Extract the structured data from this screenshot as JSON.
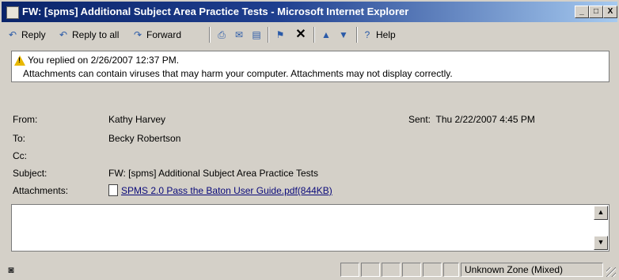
{
  "window": {
    "title": "FW: [spms] Additional Subject Area Practice Tests - Microsoft Internet Explorer",
    "controls": {
      "minimize": "_",
      "maximize": "□",
      "close": "X"
    }
  },
  "toolbar": {
    "reply": "Reply",
    "reply_all": "Reply to all",
    "forward": "Forward",
    "help": "Help"
  },
  "infobar": {
    "replied": "You replied on 2/26/2007 12:37 PM.",
    "attachment_warning": "Attachments can contain viruses that may harm your computer. Attachments may not display correctly."
  },
  "header": {
    "from_label": "From:",
    "from_value": "Kathy Harvey",
    "sent_label": "Sent:",
    "sent_value": "Thu 2/22/2007 4:45 PM",
    "to_label": "To:",
    "to_value": "Becky Robertson",
    "cc_label": "Cc:",
    "cc_value": "",
    "subject_label": "Subject:",
    "subject_value": "FW: [spms] Additional Subject Area Practice Tests",
    "attachments_label": "Attachments:",
    "attachment_name": "SPMS 2.0  Pass the Baton User Guide.pdf(844KB)"
  },
  "statusbar": {
    "zone": "Unknown Zone (Mixed)"
  },
  "colors": {
    "titlebar_start": "#0a246a",
    "titlebar_end": "#a6caf0",
    "chrome": "#d4d0c8"
  }
}
